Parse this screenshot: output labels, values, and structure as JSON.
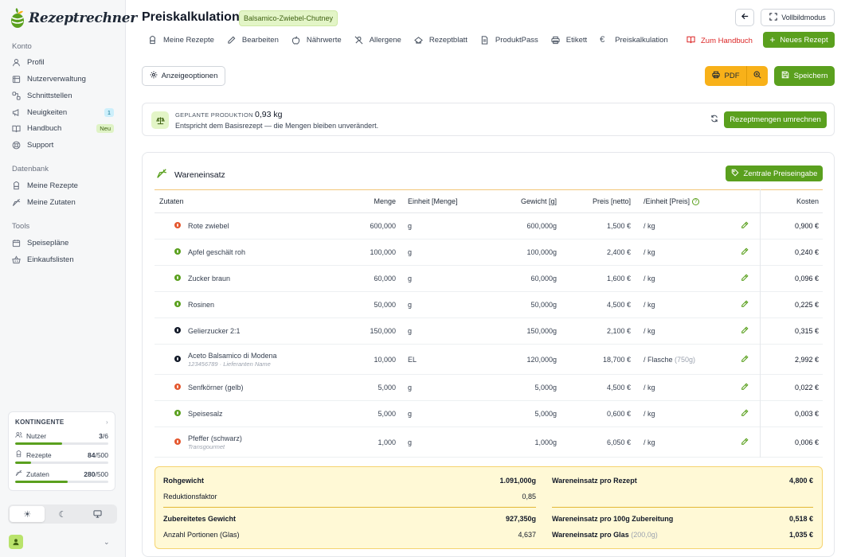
{
  "brand": {
    "name": "Rezeptrechner"
  },
  "sidebar": {
    "sections": [
      {
        "title": "Konto",
        "items": [
          {
            "label": "Profil",
            "icon": "user-icon"
          },
          {
            "label": "Nutzerverwaltung",
            "icon": "users-icon"
          },
          {
            "label": "Schnittstellen",
            "icon": "link-icon"
          },
          {
            "label": "Neuigkeiten",
            "icon": "megaphone-icon",
            "badge": "1"
          },
          {
            "label": "Handbuch",
            "icon": "book-icon",
            "badge": "Neu"
          },
          {
            "label": "Support",
            "icon": "lifebuoy-icon"
          }
        ]
      },
      {
        "title": "Datenbank",
        "items": [
          {
            "label": "Meine Rezepte",
            "icon": "chef-hat-icon"
          },
          {
            "label": "Meine Zutaten",
            "icon": "carrot-icon"
          }
        ]
      },
      {
        "title": "Tools",
        "items": [
          {
            "label": "Speisepläne",
            "icon": "calendar-icon"
          },
          {
            "label": "Einkaufslisten",
            "icon": "basket-icon"
          }
        ]
      }
    ],
    "quota": {
      "title": "KONTINGENTE",
      "rows": [
        {
          "label": "Nutzer",
          "used": "3",
          "total": "6",
          "fraction": 0.5
        },
        {
          "label": "Rezepte",
          "used": "84",
          "total": "500",
          "fraction": 0.168
        },
        {
          "label": "Zutaten",
          "used": "280",
          "total": "500",
          "fraction": 0.56
        }
      ]
    },
    "theme": {
      "options": [
        "sun-icon",
        "moon-icon",
        "monitor-icon"
      ],
      "active": 0
    }
  },
  "header": {
    "title": "Preiskalkulation",
    "recipe": "Balsamico-Zwiebel-Chutney",
    "fullscreen_label": "Vollbildmodus"
  },
  "tabs": [
    {
      "label": "Meine Rezepte",
      "icon": "chef-hat-icon"
    },
    {
      "label": "Bearbeiten",
      "icon": "pencil-icon"
    },
    {
      "label": "Nährwerte",
      "icon": "apple-icon"
    },
    {
      "label": "Allergene",
      "icon": "wheat-off-icon"
    },
    {
      "label": "Rezeptblatt",
      "icon": "hat-icon"
    },
    {
      "label": "ProduktPass",
      "icon": "document-icon"
    },
    {
      "label": "Etikett",
      "icon": "printer-icon"
    },
    {
      "label": "Preiskalkulation",
      "icon": "euro-icon"
    }
  ],
  "handbook_link": "Zum Handbuch",
  "new_recipe_label": "Neues Rezept",
  "toolbar": {
    "options_label": "Anzeigeoptionen",
    "pdf_label": "PDF",
    "save_label": "Speichern"
  },
  "production": {
    "label": "GEPLANTE PRODUKTION",
    "value": "0,93 kg",
    "description": "Entspricht dem Basisrezept — die Mengen bleiben unverändert.",
    "convert_label": "Rezeptmengen umrechnen"
  },
  "wareneinsatz": {
    "title": "Wareneinsatz",
    "central_price_label": "Zentrale Preiseingabe",
    "columns": {
      "zutaten": "Zutaten",
      "menge": "Menge",
      "einheit": "Einheit [Menge]",
      "gewicht": "Gewicht [g]",
      "preis": "Preis [netto]",
      "per_einheit": "/Einheit [Preis]",
      "kosten": "Kosten"
    },
    "rows": [
      {
        "dot": "red",
        "name": "Rote zwiebel",
        "sub": "",
        "menge": "600,000",
        "einheit": "g",
        "gewicht": "600,000g",
        "preis": "1,500 €",
        "per": "/ kg",
        "per_extra": "",
        "kosten": "0,900 €"
      },
      {
        "dot": "green",
        "name": "Apfel geschält roh",
        "sub": "",
        "menge": "100,000",
        "einheit": "g",
        "gewicht": "100,000g",
        "preis": "2,400 €",
        "per": "/ kg",
        "per_extra": "",
        "kosten": "0,240 €"
      },
      {
        "dot": "green",
        "name": "Zucker braun",
        "sub": "",
        "menge": "60,000",
        "einheit": "g",
        "gewicht": "60,000g",
        "preis": "1,600 €",
        "per": "/ kg",
        "per_extra": "",
        "kosten": "0,096 €"
      },
      {
        "dot": "green",
        "name": "Rosinen",
        "sub": "",
        "menge": "50,000",
        "einheit": "g",
        "gewicht": "50,000g",
        "preis": "4,500 €",
        "per": "/ kg",
        "per_extra": "",
        "kosten": "0,225 €"
      },
      {
        "dot": "black",
        "name": "Gelierzucker 2:1",
        "sub": "",
        "menge": "150,000",
        "einheit": "g",
        "gewicht": "150,000g",
        "preis": "2,100 €",
        "per": "/ kg",
        "per_extra": "",
        "kosten": "0,315 €"
      },
      {
        "dot": "black",
        "name": "Aceto Balsamico di Modena",
        "sub": "123456789 · Lieferanten Name",
        "menge": "10,000",
        "einheit": "EL",
        "gewicht": "120,000g",
        "preis": "18,700 €",
        "per": "/ Flasche",
        "per_extra": "(750g)",
        "kosten": "2,992 €"
      },
      {
        "dot": "red",
        "name": "Senfkörner (gelb)",
        "sub": "",
        "menge": "5,000",
        "einheit": "g",
        "gewicht": "5,000g",
        "preis": "4,500 €",
        "per": "/ kg",
        "per_extra": "",
        "kosten": "0,022 €"
      },
      {
        "dot": "green",
        "name": "Speisesalz",
        "sub": "",
        "menge": "5,000",
        "einheit": "g",
        "gewicht": "5,000g",
        "preis": "0,600 €",
        "per": "/ kg",
        "per_extra": "",
        "kosten": "0,003 €"
      },
      {
        "dot": "red",
        "name": "Pfeffer (schwarz)",
        "sub": "Transgourmet",
        "menge": "1,000",
        "einheit": "g",
        "gewicht": "1,000g",
        "preis": "6,050 €",
        "per": "/ kg",
        "per_extra": "",
        "kosten": "0,006 €"
      }
    ],
    "summary": {
      "left": [
        {
          "label": "Rohgewicht",
          "value": "1.091,000g",
          "bold": true
        },
        {
          "label": "Reduktionsfaktor",
          "value": "0,85",
          "bold": false
        },
        {
          "label": "Zubereitetes Gewicht",
          "value": "927,350g",
          "bold": true
        },
        {
          "label": "Anzahl Portionen (Glas)",
          "value": "4,637",
          "bold": false
        }
      ],
      "right": [
        {
          "label": "Wareneinsatz pro Rezept",
          "extra": "",
          "value": "4,800 €"
        },
        {
          "label": "Wareneinsatz pro 100g Zubereitung",
          "extra": "",
          "value": "0,518 €"
        },
        {
          "label": "Wareneinsatz pro Glas",
          "extra": "(200,0g)",
          "value": "1,035 €"
        }
      ]
    }
  }
}
